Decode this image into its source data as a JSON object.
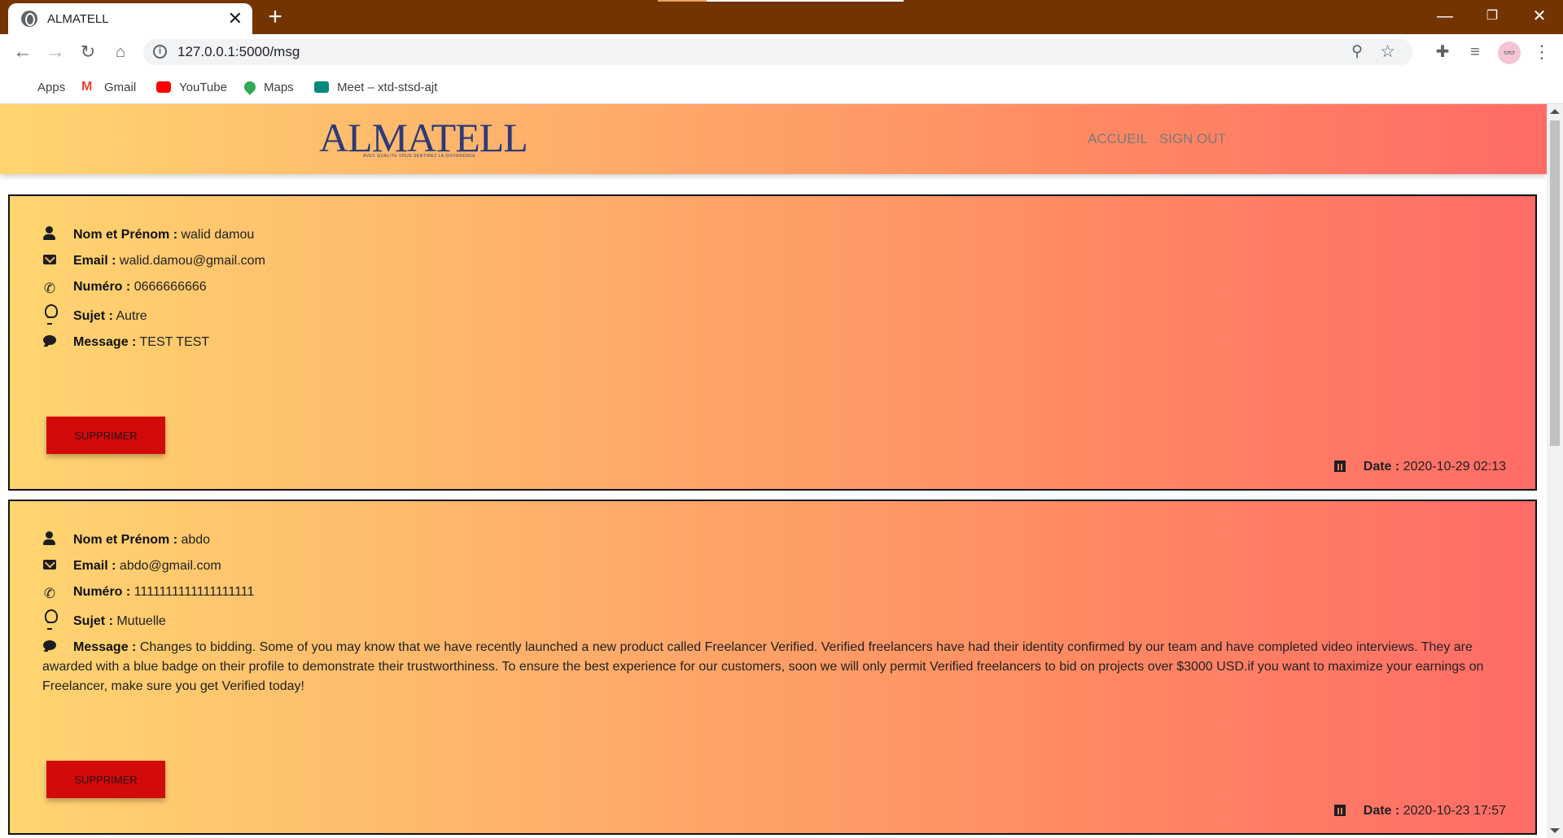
{
  "browser": {
    "tab_title": "ALMATELL",
    "tab_close": "✕",
    "new_tab": "+",
    "url": "127.0.0.1:5000/msg",
    "window_controls": {
      "minimize": "—",
      "restore": "❐",
      "close": "✕"
    },
    "bookmarks": [
      {
        "label": "Apps",
        "icon": "apps-grid-icon"
      },
      {
        "label": "Gmail",
        "icon": "gmail-icon"
      },
      {
        "label": "YouTube",
        "icon": "youtube-icon"
      },
      {
        "label": "Maps",
        "icon": "maps-pin-icon"
      },
      {
        "label": "Meet – xtd-stsd-ajt",
        "icon": "meet-icon"
      }
    ]
  },
  "site": {
    "logo_text": "ALMATELL",
    "logo_tagline": "AVEC QUALITE VOUS SENTIREZ LA DIFFERENCE",
    "nav": {
      "home": "ACCUEIL",
      "signout": "SIGN OUT"
    },
    "colors": {
      "gradient_start": "#ffd570",
      "gradient_end": "#ff6b67",
      "delete_button": "#d20a0a"
    }
  },
  "labels": {
    "name": "Nom et Prénom :",
    "email": "Email :",
    "phone": "Numéro :",
    "subject": "Sujet :",
    "message": "Message :",
    "date": "Date :",
    "delete": "SUPPRIMER"
  },
  "messages": [
    {
      "name": "walid damou",
      "email": "walid.damou@gmail.com",
      "phone": "0666666666",
      "subject": "Autre",
      "message": "TEST TEST",
      "date": "2020-10-29 02:13"
    },
    {
      "name": "abdo",
      "email": "abdo@gmail.com",
      "phone": "1111111111111111111",
      "subject": "Mutuelle",
      "message": "Changes to bidding. Some of you may know that we have recently launched a new product called Freelancer Verified. Verified freelancers have had their identity confirmed by our team and have completed video interviews. They are awarded with a blue badge on their profile to demonstrate their trustworthiness. To ensure the best experience for our customers, soon we will only permit Verified freelancers to bid on projects over $3000 USD.if you want to maximize your earnings on Freelancer, make sure you get Verified today!",
      "date": "2020-10-23 17:57"
    }
  ]
}
